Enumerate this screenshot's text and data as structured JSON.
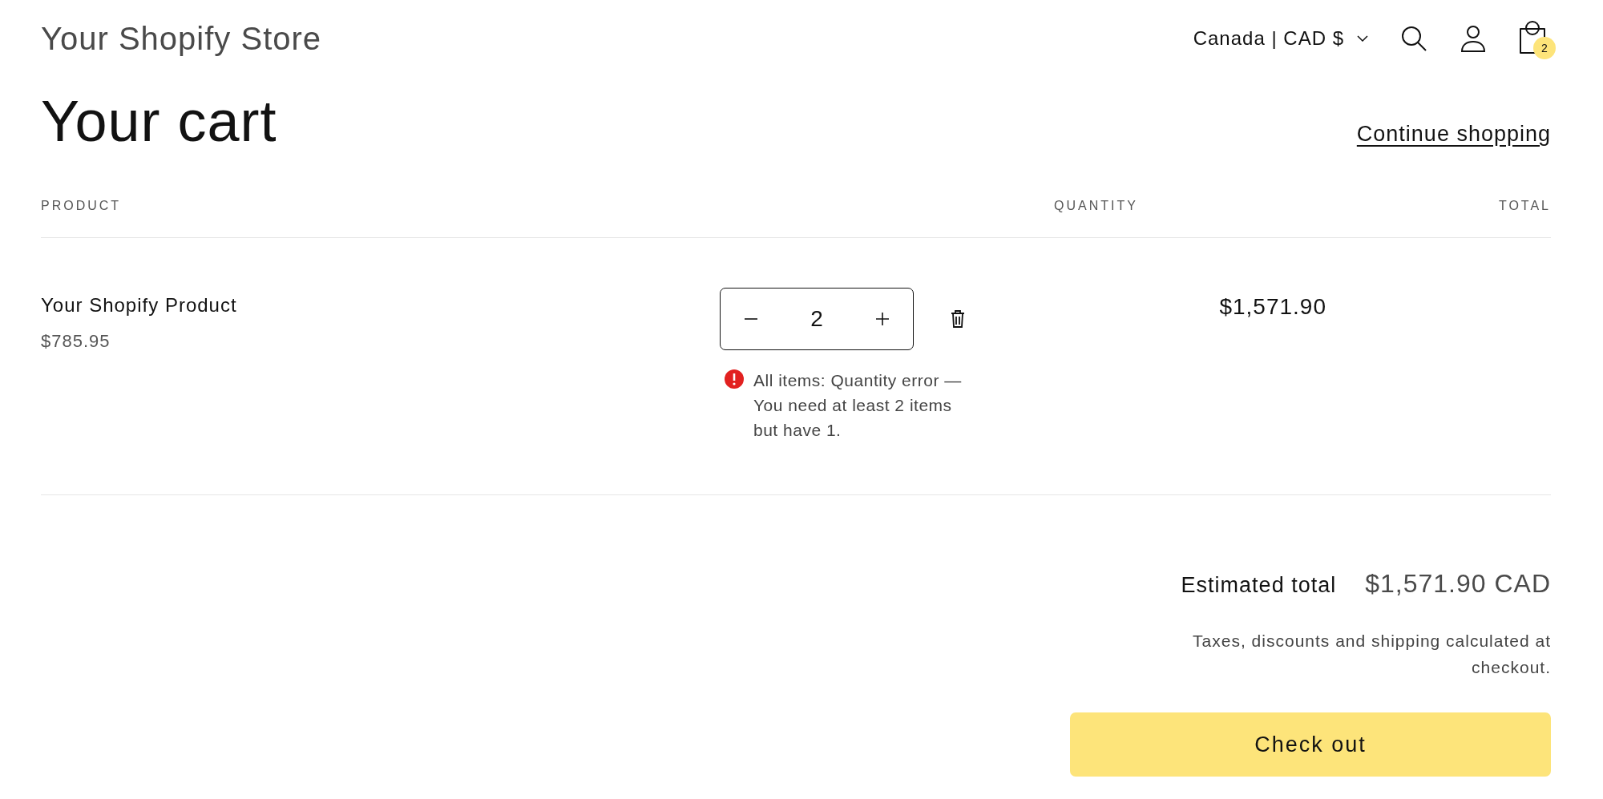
{
  "header": {
    "store_name": "Your Shopify Store",
    "currency": "Canada | CAD $",
    "cart_count": "2"
  },
  "title": "Your cart",
  "continue_link": "Continue shopping",
  "columns": [
    "PRODUCT",
    "QUANTITY",
    "TOTAL"
  ],
  "items": [
    {
      "name": "Your Shopify Product",
      "price": "$785.95",
      "quantity": "2",
      "total": "$1,571.90",
      "error": "All items: Quantity error — You need at least 2 items but have 1."
    }
  ],
  "summary": {
    "label": "Estimated total",
    "value": "$1,571.90 CAD",
    "note": "Taxes, discounts and shipping calculated at checkout."
  },
  "checkout_button": "Check out"
}
